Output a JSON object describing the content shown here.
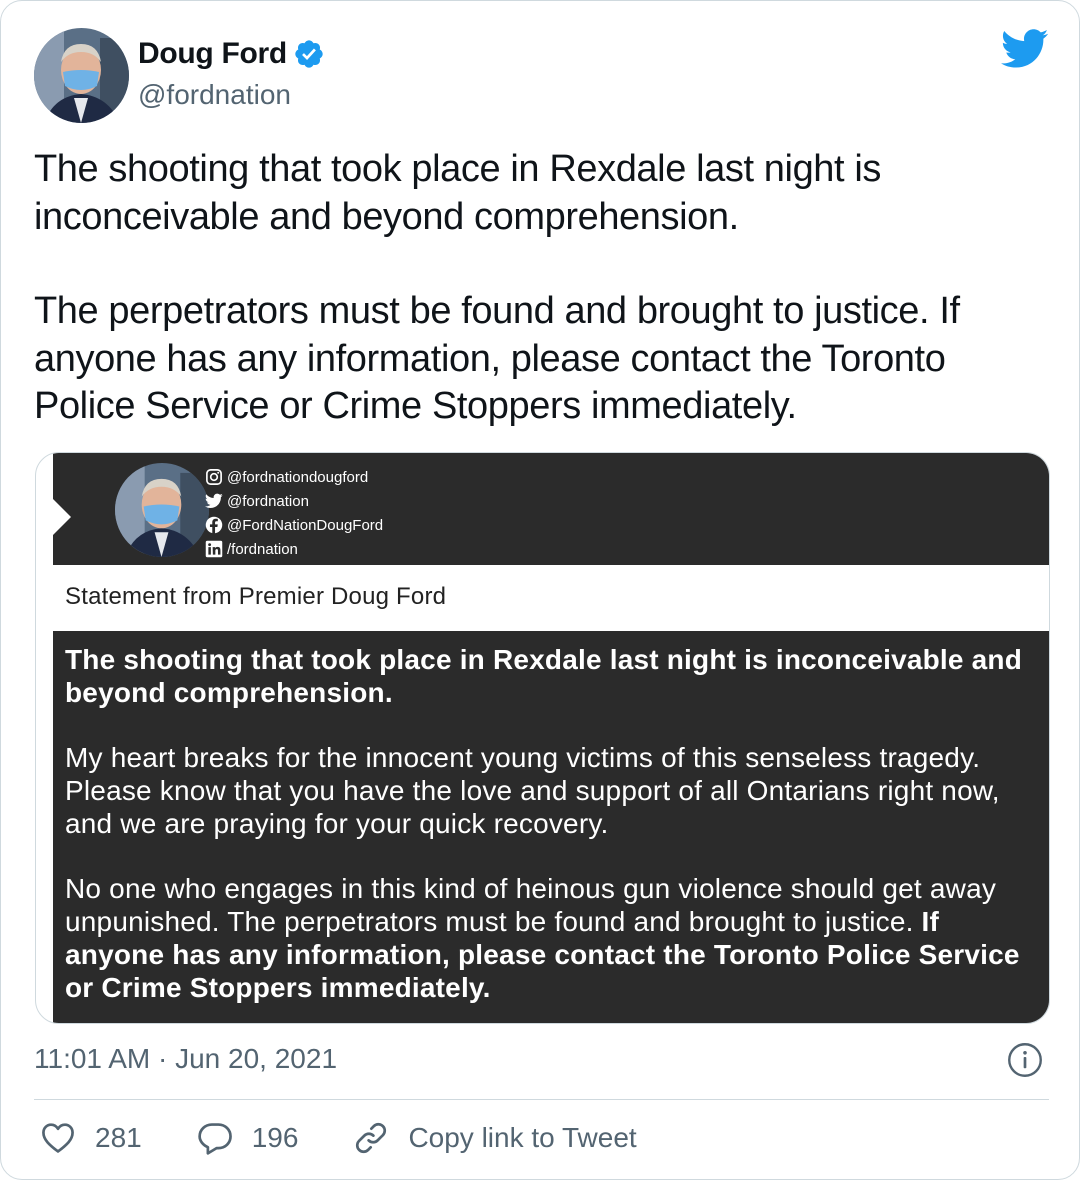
{
  "tweet": {
    "author_name": "Doug Ford",
    "author_handle": "@fordnation",
    "text_paragraphs": [
      "The shooting that took place in Rexdale last night is inconceivable and beyond comprehension.",
      "The perpetrators must be found and brought to justice. If anyone has any information, please contact the Toronto Police Service or Crime Stoppers immediately."
    ],
    "timestamp": "11:01 AM · Jun 20, 2021",
    "likes": "281",
    "replies": "196",
    "copy_link_label": "Copy link to Tweet"
  },
  "media": {
    "socials": [
      {
        "icon": "instagram-icon",
        "label": "@fordnationdougford"
      },
      {
        "icon": "twitter-icon",
        "label": "@fordnation"
      },
      {
        "icon": "facebook-icon",
        "label": "@FordNationDougFord"
      },
      {
        "icon": "linkedin-icon",
        "label": "/fordnation"
      }
    ],
    "title": "Statement from Premier Doug Ford",
    "para1_bold": "The shooting that took place in Rexdale last night is inconceivable and beyond comprehension.",
    "para2": "My heart breaks for the innocent young victims of this senseless tragedy. Please know that you have the love and support of all Ontarians right now, and we are praying for your quick recovery.",
    "para3_regular": "No one who engages in this kind of heinous gun violence should get away unpunished. The perpetrators must be found and brought to justice. ",
    "para3_bold": "If anyone has any information, please contact the Toronto Police Service or Crime Stoppers immediately."
  },
  "colors": {
    "brand_blue": "#1d9bf0",
    "secondary_text": "#536471",
    "media_dark": "#2b2b2b"
  }
}
